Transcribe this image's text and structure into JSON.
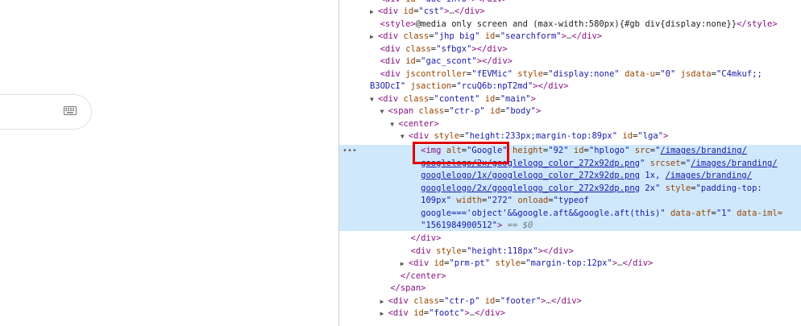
{
  "left": {
    "keyboard_icon": "keyboard-icon"
  },
  "dom": {
    "l0": "div id=\"doc-info\"></div>",
    "l1": {
      "id": "cst"
    },
    "l2": "@media only screen and (max-width:580px){#gb div{display:none}}",
    "l3": {
      "class": "jhp big",
      "id": "searchform"
    },
    "l4": {
      "class": "sfbgx"
    },
    "l5": {
      "id": "gac_scont"
    },
    "l6": {
      "jscontroller": "fEVMic",
      "style": "display:none",
      "data_u": "0",
      "jsdata": "C4mkuf;;"
    },
    "l7": {
      "jsdata_cont": "B3ODcI",
      "jsaction": "rcuQ6b:npT2md"
    },
    "l8": {
      "class": "content",
      "id": "main"
    },
    "l9": {
      "class": "ctr-p",
      "id": "body"
    },
    "l11": {
      "style": "height:233px;margin-top:89px",
      "id": "lga"
    },
    "img": {
      "alt": "Google",
      "height": "92",
      "id": "hplogo",
      "src": "/images/branding/",
      "src2": "googlelogo/2x/googlelogo_color_272x92dp.png",
      "srcset1": "/images/branding/",
      "srcset2": "googlelogo/1x/googlelogo_color_272x92dp.png",
      "srcset2_suffix": " 1x, ",
      "srcset3": "/images/branding/",
      "srcset4": "googlelogo/2x/googlelogo_color_272x92dp.png",
      "srcset4_suffix": " 2x",
      "style": "padding-top:",
      "style2": "109px",
      "width": "272",
      "onload": "typeof",
      "onload2": "google==='object'&&google.aft&&google.aft(this)",
      "data_atf": "1",
      "data_iml_label": "data-iml=",
      "data_iml": "1561984900512",
      "eq0": "== $0"
    },
    "l_divstyle": "height:118px",
    "l_prm": {
      "id": "prm-pt",
      "style": "margin-top:12px"
    },
    "l_footer": {
      "class": "ctr-p",
      "id": "footer"
    },
    "l_footc": {
      "id": "footc"
    }
  }
}
